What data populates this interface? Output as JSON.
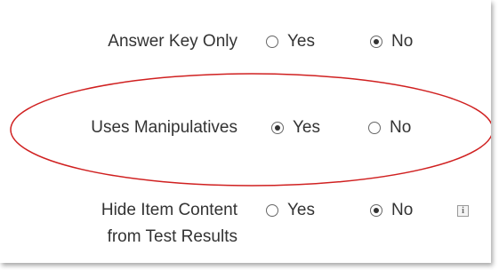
{
  "settings": [
    {
      "label_lines": [
        "Answer Key Only"
      ],
      "options": [
        {
          "label": "Yes",
          "selected": false
        },
        {
          "label": "No",
          "selected": true
        }
      ]
    },
    {
      "label_lines": [
        "Uses Manipulatives"
      ],
      "options": [
        {
          "label": "Yes",
          "selected": true
        },
        {
          "label": "No",
          "selected": false
        }
      ]
    },
    {
      "label_lines": [
        "Hide Item Content",
        "from Test Results"
      ],
      "options": [
        {
          "label": "Yes",
          "selected": false
        },
        {
          "label": "No",
          "selected": true
        }
      ],
      "info_icon": "info-icon"
    }
  ],
  "info_icon_glyph": "i",
  "colors": {
    "highlight": "#d02020",
    "text": "#333333"
  }
}
